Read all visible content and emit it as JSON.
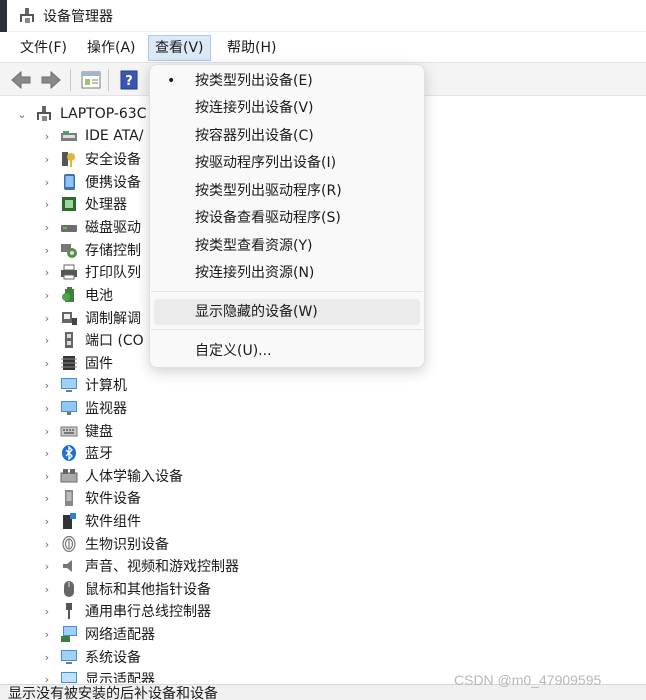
{
  "window": {
    "title": "设备管理器",
    "status_text": "显示没有被安装的后补设备和设备"
  },
  "menubar": [
    {
      "label": "文件(F)",
      "active": false
    },
    {
      "label": "操作(A)",
      "active": false
    },
    {
      "label": "查看(V)",
      "active": true
    },
    {
      "label": "帮助(H)",
      "active": false
    }
  ],
  "toolbar": {
    "icons": [
      "back-arrow-icon",
      "forward-arrow-icon",
      "properties-icon",
      "help-icon"
    ]
  },
  "tree": {
    "root": {
      "label": "LAPTOP-63C",
      "expanded": true
    },
    "items": [
      {
        "label": "IDE ATA/",
        "icon": "ide-controller-icon"
      },
      {
        "label": "安全设备",
        "icon": "security-key-icon"
      },
      {
        "label": "便携设备",
        "icon": "portable-device-icon"
      },
      {
        "label": "处理器",
        "icon": "processor-icon"
      },
      {
        "label": "磁盘驱动",
        "icon": "disk-drive-icon"
      },
      {
        "label": "存储控制",
        "icon": "storage-controller-icon"
      },
      {
        "label": "打印队列",
        "icon": "printer-icon"
      },
      {
        "label": "电池",
        "icon": "battery-icon"
      },
      {
        "label": "调制解调",
        "icon": "modem-icon"
      },
      {
        "label": "端口 (CO",
        "icon": "port-icon"
      },
      {
        "label": "固件",
        "icon": "firmware-icon"
      },
      {
        "label": "计算机",
        "icon": "computer-icon"
      },
      {
        "label": "监视器",
        "icon": "monitor-icon"
      },
      {
        "label": "键盘",
        "icon": "keyboard-icon"
      },
      {
        "label": "蓝牙",
        "icon": "bluetooth-icon"
      },
      {
        "label": "人体学输入设备",
        "icon": "hid-icon"
      },
      {
        "label": "软件设备",
        "icon": "software-device-icon"
      },
      {
        "label": "软件组件",
        "icon": "software-component-icon"
      },
      {
        "label": "生物识别设备",
        "icon": "fingerprint-icon"
      },
      {
        "label": "声音、视频和游戏控制器",
        "icon": "speaker-icon"
      },
      {
        "label": "鼠标和其他指针设备",
        "icon": "mouse-icon"
      },
      {
        "label": "通用串行总线控制器",
        "icon": "usb-icon"
      },
      {
        "label": "网络适配器",
        "icon": "network-adapter-icon"
      },
      {
        "label": "系统设备",
        "icon": "system-device-icon"
      },
      {
        "label": "显示适配器",
        "icon": "display-adapter-icon"
      }
    ]
  },
  "view_menu": {
    "items": [
      {
        "label": "按类型列出设备(E)",
        "checked": true
      },
      {
        "label": "按连接列出设备(V)",
        "checked": false
      },
      {
        "label": "按容器列出设备(C)",
        "checked": false
      },
      {
        "label": "按驱动程序列出设备(I)",
        "checked": false
      },
      {
        "label": "按类型列出驱动程序(R)",
        "checked": false
      },
      {
        "label": "按设备查看驱动程序(S)",
        "checked": false
      },
      {
        "label": "按类型查看资源(Y)",
        "checked": false
      },
      {
        "label": "按连接列出资源(N)",
        "checked": false
      }
    ],
    "show_hidden": {
      "label": "显示隐藏的设备(W)",
      "hovered": true
    },
    "customize": {
      "label": "自定义(U)..."
    },
    "checked_mark": "•"
  },
  "watermark": "CSDN @m0_47909595",
  "colors": {
    "menu_active_bg": "#dbe9f7",
    "menu_active_border": "#a9cbee",
    "dropdown_bg": "#f9f9f9",
    "hover_bg": "#ebebeb"
  }
}
